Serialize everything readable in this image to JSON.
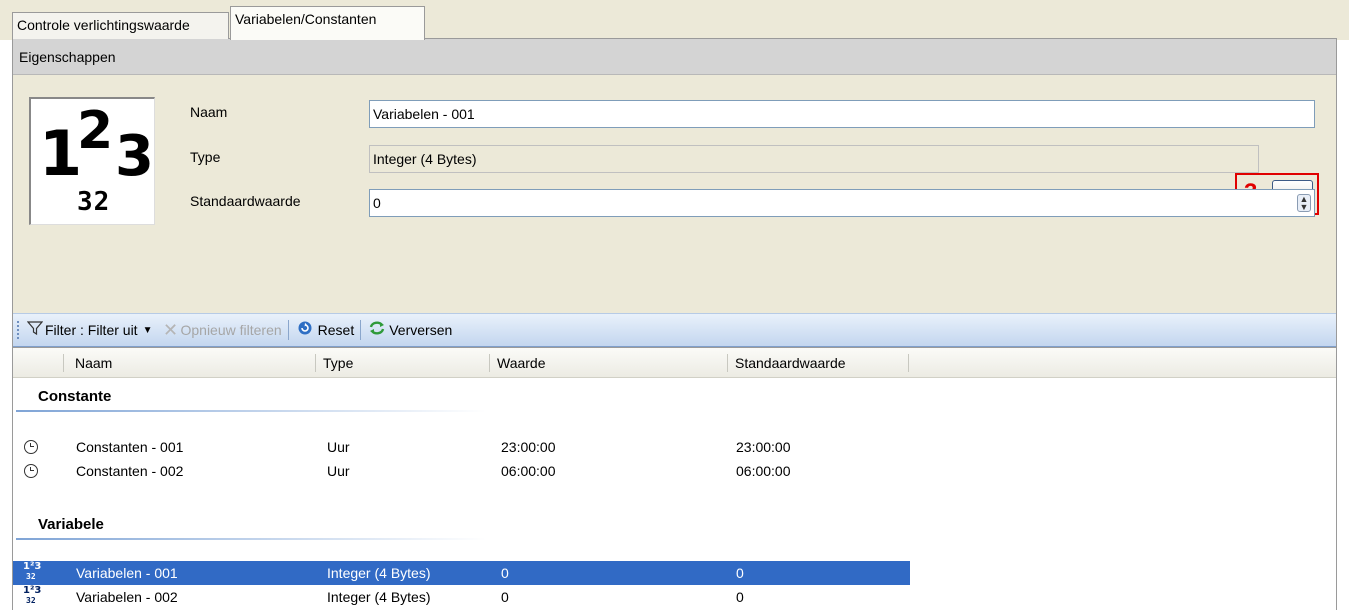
{
  "tabs": [
    {
      "label": "Controle verlichtingswaarde",
      "active": false
    },
    {
      "label": "Variabelen/Constanten",
      "active": true
    }
  ],
  "properties": {
    "header": "Eigenschappen",
    "icon": {
      "digits": [
        "1",
        "2",
        "3"
      ],
      "sub": "32"
    },
    "name_label": "Naam",
    "name_value": "Variabelen - 001",
    "type_label": "Type",
    "type_value": "Integer (4 Bytes)",
    "type_button": "...",
    "default_label": "Standaardwaarde",
    "default_value": "0",
    "callout": "3"
  },
  "toolbar": {
    "filter_label": "Filter : Filter uit",
    "refilter_label": "Opnieuw filteren",
    "reset_label": "Reset",
    "refresh_label": "Verversen"
  },
  "grid": {
    "columns": [
      "Naam",
      "Type",
      "Waarde",
      "Standaardwaarde"
    ],
    "groups": [
      {
        "title": "Constante",
        "rows": [
          {
            "icon": "clock-icon",
            "naam": "Constanten - 001",
            "type": "Uur",
            "waarde": "23:00:00",
            "standaard": "23:00:00"
          },
          {
            "icon": "clock-icon",
            "naam": "Constanten - 002",
            "type": "Uur",
            "waarde": "06:00:00",
            "standaard": "06:00:00"
          }
        ]
      },
      {
        "title": "Variabele",
        "rows": [
          {
            "icon": "integer-icon",
            "naam": "Variabelen - 001",
            "type": "Integer (4 Bytes)",
            "waarde": "0",
            "standaard": "0",
            "selected": true
          },
          {
            "icon": "integer-icon",
            "naam": "Variabelen - 002",
            "type": "Integer (4 Bytes)",
            "waarde": "0",
            "standaard": "0"
          }
        ]
      }
    ]
  },
  "colors": {
    "selection": "#316ac5",
    "callout": "#e00000",
    "toolbar": "#c3d6ef"
  }
}
